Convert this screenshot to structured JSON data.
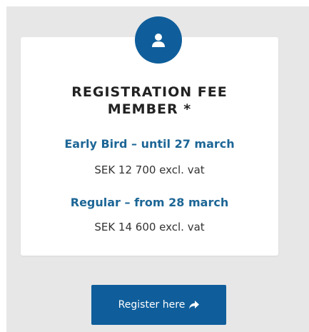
{
  "card": {
    "title_line1": "REGISTRATION FEE",
    "title_line2": "MEMBER *",
    "tiers": [
      {
        "label": "Early Bird – until 27 march",
        "price": "SEK 12 700 excl. vat"
      },
      {
        "label": "Regular – from 28 march",
        "price": "SEK 14 600 excl. vat"
      }
    ]
  },
  "cta": {
    "label": "Register here"
  },
  "icons": {
    "avatar": "user-icon",
    "button": "share-arrow-icon"
  },
  "colors": {
    "accent": "#0f5e9b",
    "tier_label": "#1d6696",
    "panel_bg": "#e7e7e7",
    "card_bg": "#ffffff"
  }
}
